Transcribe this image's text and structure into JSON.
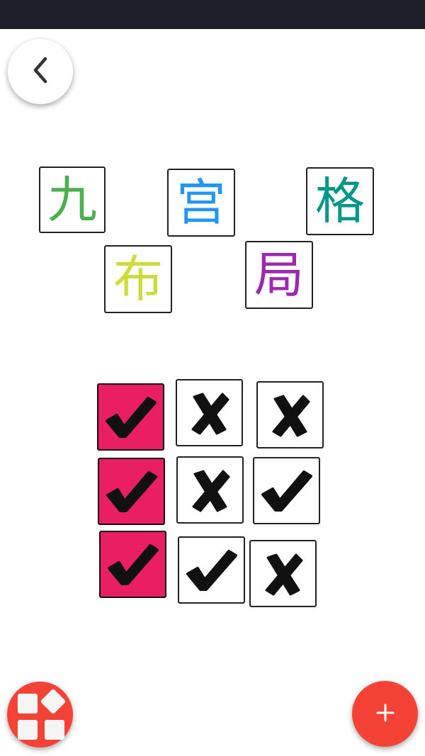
{
  "header": {
    "back_icon": "chevron-left-icon"
  },
  "title_tiles": [
    {
      "char": "九",
      "color": "#4caf50"
    },
    {
      "char": "宫",
      "color": "#2196f3"
    },
    {
      "char": "格",
      "color": "#009688"
    },
    {
      "char": "布",
      "color": "#cddc39"
    },
    {
      "char": "局",
      "color": "#9c27b0"
    }
  ],
  "grid": {
    "rows": [
      [
        "check",
        "cross",
        "cross"
      ],
      [
        "check",
        "cross",
        "check"
      ],
      [
        "check",
        "check",
        "cross"
      ]
    ],
    "highlighted_column": 0,
    "highlight_color": "#e91e63"
  },
  "footer": {
    "menu_icon": "grid-layout-icon",
    "add_icon": "plus-icon",
    "accent_color": "#f44336"
  }
}
